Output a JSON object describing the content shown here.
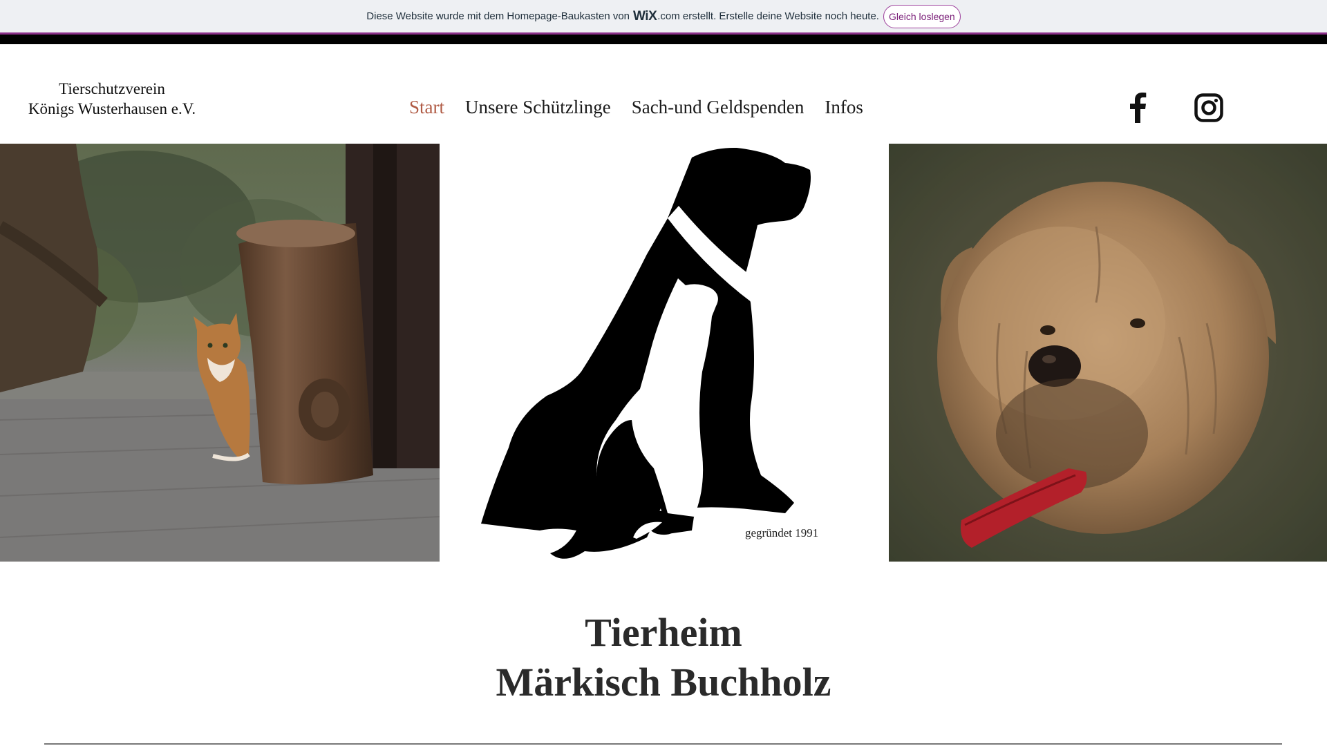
{
  "wix_banner": {
    "text_before": "Diese Website wurde mit dem Homepage-Baukasten von",
    "logo": "WiX",
    "text_after": ".com erstellt. Erstelle deine Website noch heute.",
    "cta": "Gleich loslegen",
    "accent_color": "#8b2f89"
  },
  "header": {
    "site_title_line1": "Tierschutzverein",
    "site_title_line2": "Königs Wusterhausen e.V.",
    "nav": [
      {
        "label": "Start",
        "active": true
      },
      {
        "label": "Unsere Schützlinge",
        "active": false
      },
      {
        "label": "Sach-und Geldspenden",
        "active": false
      },
      {
        "label": "Infos",
        "active": false
      }
    ],
    "active_color": "#b05b45",
    "social": [
      "facebook-icon",
      "instagram-icon"
    ]
  },
  "hero": {
    "left_image": "cat-peeking-behind-tree-stump",
    "center_logo_caption": "gegründet 1991",
    "right_image": "scruffy-dog-with-red-collar"
  },
  "main": {
    "title_line1": "Tierheim",
    "title_line2": "Märkisch Buchholz"
  }
}
